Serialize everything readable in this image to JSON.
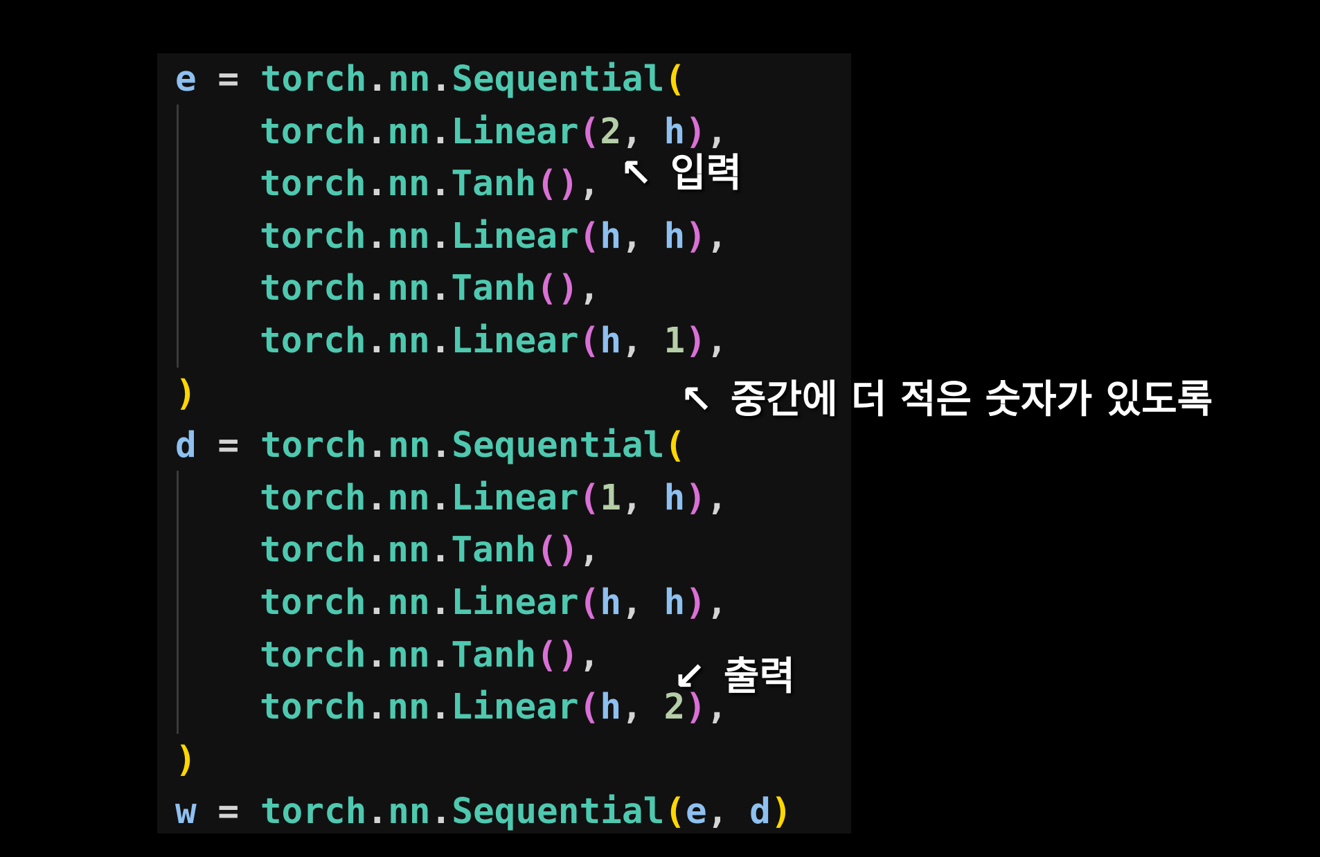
{
  "colors": {
    "background": "#000000",
    "panel": "#111111",
    "identifier": "#8ec0f0",
    "operator": "#d4d4d4",
    "module": "#4ec9b0",
    "dot": "#d4d4d4",
    "bracket_outer": "#ffd700",
    "bracket_inner": "#da70d6",
    "number": "#b5cea8",
    "punct": "#d4d4d4",
    "annotation_text": "#ffffff"
  },
  "code": {
    "lines": [
      {
        "tokens": [
          {
            "t": "e",
            "c": "identifier"
          },
          {
            "t": " = ",
            "c": "operator"
          },
          {
            "t": "torch",
            "c": "module"
          },
          {
            "t": ".",
            "c": "dot"
          },
          {
            "t": "nn",
            "c": "module"
          },
          {
            "t": ".",
            "c": "dot"
          },
          {
            "t": "Sequential",
            "c": "module"
          },
          {
            "t": "(",
            "c": "bracket_outer"
          }
        ]
      },
      {
        "indent": true,
        "tokens": [
          {
            "t": "torch",
            "c": "module"
          },
          {
            "t": ".",
            "c": "dot"
          },
          {
            "t": "nn",
            "c": "module"
          },
          {
            "t": ".",
            "c": "dot"
          },
          {
            "t": "Linear",
            "c": "module"
          },
          {
            "t": "(",
            "c": "bracket_inner"
          },
          {
            "t": "2",
            "c": "number"
          },
          {
            "t": ", ",
            "c": "punct"
          },
          {
            "t": "h",
            "c": "identifier"
          },
          {
            "t": ")",
            "c": "bracket_inner"
          },
          {
            "t": ",",
            "c": "punct"
          }
        ]
      },
      {
        "indent": true,
        "tokens": [
          {
            "t": "torch",
            "c": "module"
          },
          {
            "t": ".",
            "c": "dot"
          },
          {
            "t": "nn",
            "c": "module"
          },
          {
            "t": ".",
            "c": "dot"
          },
          {
            "t": "Tanh",
            "c": "module"
          },
          {
            "t": "()",
            "c": "bracket_inner"
          },
          {
            "t": ",",
            "c": "punct"
          }
        ]
      },
      {
        "indent": true,
        "tokens": [
          {
            "t": "torch",
            "c": "module"
          },
          {
            "t": ".",
            "c": "dot"
          },
          {
            "t": "nn",
            "c": "module"
          },
          {
            "t": ".",
            "c": "dot"
          },
          {
            "t": "Linear",
            "c": "module"
          },
          {
            "t": "(",
            "c": "bracket_inner"
          },
          {
            "t": "h",
            "c": "identifier"
          },
          {
            "t": ", ",
            "c": "punct"
          },
          {
            "t": "h",
            "c": "identifier"
          },
          {
            "t": ")",
            "c": "bracket_inner"
          },
          {
            "t": ",",
            "c": "punct"
          }
        ]
      },
      {
        "indent": true,
        "tokens": [
          {
            "t": "torch",
            "c": "module"
          },
          {
            "t": ".",
            "c": "dot"
          },
          {
            "t": "nn",
            "c": "module"
          },
          {
            "t": ".",
            "c": "dot"
          },
          {
            "t": "Tanh",
            "c": "module"
          },
          {
            "t": "()",
            "c": "bracket_inner"
          },
          {
            "t": ",",
            "c": "punct"
          }
        ]
      },
      {
        "indent": true,
        "tokens": [
          {
            "t": "torch",
            "c": "module"
          },
          {
            "t": ".",
            "c": "dot"
          },
          {
            "t": "nn",
            "c": "module"
          },
          {
            "t": ".",
            "c": "dot"
          },
          {
            "t": "Linear",
            "c": "module"
          },
          {
            "t": "(",
            "c": "bracket_inner"
          },
          {
            "t": "h",
            "c": "identifier"
          },
          {
            "t": ", ",
            "c": "punct"
          },
          {
            "t": "1",
            "c": "number"
          },
          {
            "t": ")",
            "c": "bracket_inner"
          },
          {
            "t": ",",
            "c": "punct"
          }
        ]
      },
      {
        "tokens": [
          {
            "t": ")",
            "c": "bracket_outer"
          }
        ]
      },
      {
        "tokens": [
          {
            "t": "d",
            "c": "identifier"
          },
          {
            "t": " = ",
            "c": "operator"
          },
          {
            "t": "torch",
            "c": "module"
          },
          {
            "t": ".",
            "c": "dot"
          },
          {
            "t": "nn",
            "c": "module"
          },
          {
            "t": ".",
            "c": "dot"
          },
          {
            "t": "Sequential",
            "c": "module"
          },
          {
            "t": "(",
            "c": "bracket_outer"
          }
        ]
      },
      {
        "indent": true,
        "tokens": [
          {
            "t": "torch",
            "c": "module"
          },
          {
            "t": ".",
            "c": "dot"
          },
          {
            "t": "nn",
            "c": "module"
          },
          {
            "t": ".",
            "c": "dot"
          },
          {
            "t": "Linear",
            "c": "module"
          },
          {
            "t": "(",
            "c": "bracket_inner"
          },
          {
            "t": "1",
            "c": "number"
          },
          {
            "t": ", ",
            "c": "punct"
          },
          {
            "t": "h",
            "c": "identifier"
          },
          {
            "t": ")",
            "c": "bracket_inner"
          },
          {
            "t": ",",
            "c": "punct"
          }
        ]
      },
      {
        "indent": true,
        "tokens": [
          {
            "t": "torch",
            "c": "module"
          },
          {
            "t": ".",
            "c": "dot"
          },
          {
            "t": "nn",
            "c": "module"
          },
          {
            "t": ".",
            "c": "dot"
          },
          {
            "t": "Tanh",
            "c": "module"
          },
          {
            "t": "()",
            "c": "bracket_inner"
          },
          {
            "t": ",",
            "c": "punct"
          }
        ]
      },
      {
        "indent": true,
        "tokens": [
          {
            "t": "torch",
            "c": "module"
          },
          {
            "t": ".",
            "c": "dot"
          },
          {
            "t": "nn",
            "c": "module"
          },
          {
            "t": ".",
            "c": "dot"
          },
          {
            "t": "Linear",
            "c": "module"
          },
          {
            "t": "(",
            "c": "bracket_inner"
          },
          {
            "t": "h",
            "c": "identifier"
          },
          {
            "t": ", ",
            "c": "punct"
          },
          {
            "t": "h",
            "c": "identifier"
          },
          {
            "t": ")",
            "c": "bracket_inner"
          },
          {
            "t": ",",
            "c": "punct"
          }
        ]
      },
      {
        "indent": true,
        "tokens": [
          {
            "t": "torch",
            "c": "module"
          },
          {
            "t": ".",
            "c": "dot"
          },
          {
            "t": "nn",
            "c": "module"
          },
          {
            "t": ".",
            "c": "dot"
          },
          {
            "t": "Tanh",
            "c": "module"
          },
          {
            "t": "()",
            "c": "bracket_inner"
          },
          {
            "t": ",",
            "c": "punct"
          }
        ]
      },
      {
        "indent": true,
        "tokens": [
          {
            "t": "torch",
            "c": "module"
          },
          {
            "t": ".",
            "c": "dot"
          },
          {
            "t": "nn",
            "c": "module"
          },
          {
            "t": ".",
            "c": "dot"
          },
          {
            "t": "Linear",
            "c": "module"
          },
          {
            "t": "(",
            "c": "bracket_inner"
          },
          {
            "t": "h",
            "c": "identifier"
          },
          {
            "t": ", ",
            "c": "punct"
          },
          {
            "t": "2",
            "c": "number"
          },
          {
            "t": ")",
            "c": "bracket_inner"
          },
          {
            "t": ",",
            "c": "punct"
          }
        ]
      },
      {
        "tokens": [
          {
            "t": ")",
            "c": "bracket_outer"
          }
        ]
      },
      {
        "tokens": [
          {
            "t": "w",
            "c": "identifier"
          },
          {
            "t": " = ",
            "c": "operator"
          },
          {
            "t": "torch",
            "c": "module"
          },
          {
            "t": ".",
            "c": "dot"
          },
          {
            "t": "nn",
            "c": "module"
          },
          {
            "t": ".",
            "c": "dot"
          },
          {
            "t": "Sequential",
            "c": "module"
          },
          {
            "t": "(",
            "c": "bracket_outer"
          },
          {
            "t": "e",
            "c": "identifier"
          },
          {
            "t": ", ",
            "c": "punct"
          },
          {
            "t": "d",
            "c": "identifier"
          },
          {
            "t": ")",
            "c": "bracket_outer"
          }
        ]
      }
    ]
  },
  "annotations": {
    "input": {
      "arrow": "↖",
      "text": "입력"
    },
    "middle": {
      "arrow": "↖",
      "text": "중간에 더 적은 숫자가 있도록"
    },
    "output": {
      "arrow": "↙",
      "text": "출력"
    }
  }
}
